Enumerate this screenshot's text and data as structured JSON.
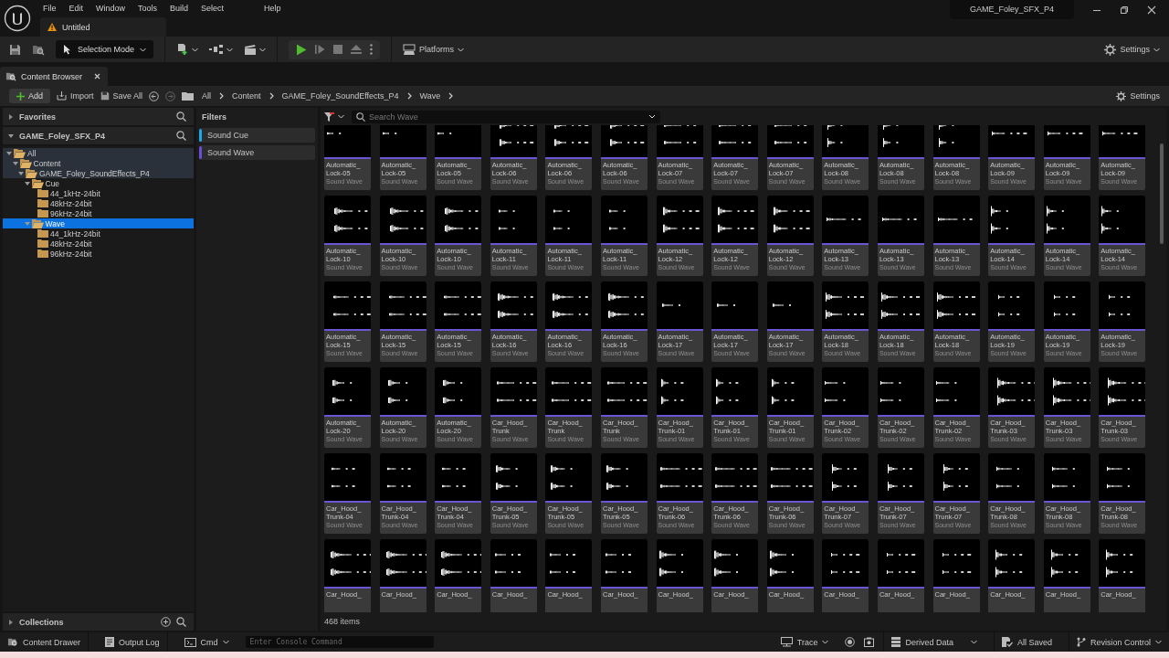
{
  "menu": [
    "File",
    "Edit",
    "Window",
    "Tools",
    "Build",
    "Select",
    "Help"
  ],
  "document_tab": {
    "title": "Untitled"
  },
  "project_name": "GAME_Foley_SFX_P4",
  "toolbar": {
    "mode": "Selection Mode",
    "platforms": "Platforms",
    "settings": "Settings"
  },
  "panel_tab": {
    "title": "Content Browser"
  },
  "browser_toolbar": {
    "add": "Add",
    "import": "Import",
    "save_all": "Save All",
    "breadcrumb": [
      "All",
      "Content",
      "GAME_Foley_SoundEffects_P4",
      "Wave"
    ],
    "settings": "Settings"
  },
  "sources": {
    "favorites": {
      "label": "Favorites",
      "expanded": false
    },
    "project": {
      "label": "GAME_Foley_SFX_P4",
      "expanded": true
    },
    "tree": [
      {
        "label": "All",
        "expanded": true,
        "selected": false,
        "children": [
          {
            "label": "Content",
            "expanded": true,
            "selected": false,
            "children": [
              {
                "label": "GAME_Foley_SoundEffects_P4",
                "expanded": true,
                "selected": false,
                "children": [
                  {
                    "label": "Cue",
                    "expanded": true,
                    "selected": false,
                    "children": [
                      {
                        "label": "44_1kHz-24bit",
                        "selected": false
                      },
                      {
                        "label": "48kHz-24bit",
                        "selected": false
                      },
                      {
                        "label": "96kHz-24bit",
                        "selected": false
                      }
                    ]
                  },
                  {
                    "label": "Wave",
                    "expanded": true,
                    "selected": true,
                    "children": [
                      {
                        "label": "44_1kHz-24bit",
                        "selected": false
                      },
                      {
                        "label": "48kHz-24bit",
                        "selected": false
                      },
                      {
                        "label": "96kHz-24bit",
                        "selected": false
                      }
                    ]
                  }
                ]
              }
            ]
          }
        ]
      }
    ],
    "collections": {
      "label": "Collections",
      "expanded": false
    }
  },
  "filters": {
    "title": "Filters",
    "items": [
      {
        "label": "Sound Cue",
        "color": "#1ca7ec"
      },
      {
        "label": "Sound Wave",
        "color": "#6b4fd6"
      }
    ]
  },
  "search": {
    "placeholder": "Search Wave"
  },
  "assets": [
    {
      "name": "Automatic_\nLock-05",
      "type": "Sound Wave"
    },
    {
      "name": "Automatic_\nLock-05",
      "type": "Sound Wave"
    },
    {
      "name": "Automatic_\nLock-05",
      "type": "Sound Wave"
    },
    {
      "name": "Automatic_\nLock-06",
      "type": "Sound Wave"
    },
    {
      "name": "Automatic_\nLock-06",
      "type": "Sound Wave"
    },
    {
      "name": "Automatic_\nLock-06",
      "type": "Sound Wave"
    },
    {
      "name": "Automatic_\nLock-07",
      "type": "Sound Wave"
    },
    {
      "name": "Automatic_\nLock-07",
      "type": "Sound Wave"
    },
    {
      "name": "Automatic_\nLock-07",
      "type": "Sound Wave"
    },
    {
      "name": "Automatic_\nLock-08",
      "type": "Sound Wave"
    },
    {
      "name": "Automatic_\nLock-08",
      "type": "Sound Wave"
    },
    {
      "name": "Automatic_\nLock-08",
      "type": "Sound Wave"
    },
    {
      "name": "Automatic_\nLock-09",
      "type": "Sound Wave"
    },
    {
      "name": "Automatic_\nLock-09",
      "type": "Sound Wave"
    },
    {
      "name": "Automatic_\nLock-09",
      "type": "Sound Wave"
    },
    {
      "name": "Automatic_\nLock-10",
      "type": "Sound Wave"
    },
    {
      "name": "Automatic_\nLock-10",
      "type": "Sound Wave"
    },
    {
      "name": "Automatic_\nLock-10",
      "type": "Sound Wave"
    },
    {
      "name": "Automatic_\nLock-11",
      "type": "Sound Wave"
    },
    {
      "name": "Automatic_\nLock-11",
      "type": "Sound Wave"
    },
    {
      "name": "Automatic_\nLock-11",
      "type": "Sound Wave"
    },
    {
      "name": "Automatic_\nLock-12",
      "type": "Sound Wave"
    },
    {
      "name": "Automatic_\nLock-12",
      "type": "Sound Wave"
    },
    {
      "name": "Automatic_\nLock-12",
      "type": "Sound Wave"
    },
    {
      "name": "Automatic_\nLock-13",
      "type": "Sound Wave"
    },
    {
      "name": "Automatic_\nLock-13",
      "type": "Sound Wave"
    },
    {
      "name": "Automatic_\nLock-13",
      "type": "Sound Wave"
    },
    {
      "name": "Automatic_\nLock-14",
      "type": "Sound Wave"
    },
    {
      "name": "Automatic_\nLock-14",
      "type": "Sound Wave"
    },
    {
      "name": "Automatic_\nLock-14",
      "type": "Sound Wave"
    },
    {
      "name": "Automatic_\nLock-15",
      "type": "Sound Wave"
    },
    {
      "name": "Automatic_\nLock-15",
      "type": "Sound Wave"
    },
    {
      "name": "Automatic_\nLock-15",
      "type": "Sound Wave"
    },
    {
      "name": "Automatic_\nLock-16",
      "type": "Sound Wave"
    },
    {
      "name": "Automatic_\nLock-16",
      "type": "Sound Wave"
    },
    {
      "name": "Automatic_\nLock-16",
      "type": "Sound Wave"
    },
    {
      "name": "Automatic_\nLock-17",
      "type": "Sound Wave"
    },
    {
      "name": "Automatic_\nLock-17",
      "type": "Sound Wave"
    },
    {
      "name": "Automatic_\nLock-17",
      "type": "Sound Wave"
    },
    {
      "name": "Automatic_\nLock-18",
      "type": "Sound Wave"
    },
    {
      "name": "Automatic_\nLock-18",
      "type": "Sound Wave"
    },
    {
      "name": "Automatic_\nLock-18",
      "type": "Sound Wave"
    },
    {
      "name": "Automatic_\nLock-19",
      "type": "Sound Wave"
    },
    {
      "name": "Automatic_\nLock-19",
      "type": "Sound Wave"
    },
    {
      "name": "Automatic_\nLock-19",
      "type": "Sound Wave"
    },
    {
      "name": "Automatic_\nLock-20",
      "type": "Sound Wave"
    },
    {
      "name": "Automatic_\nLock-20",
      "type": "Sound Wave"
    },
    {
      "name": "Automatic_\nLock-20",
      "type": "Sound Wave"
    },
    {
      "name": "Car_Hood_\nTrunk",
      "type": "Sound Wave"
    },
    {
      "name": "Car_Hood_\nTrunk",
      "type": "Sound Wave"
    },
    {
      "name": "Car_Hood_\nTrunk",
      "type": "Sound Wave"
    },
    {
      "name": "Car_Hood_\nTrunk-01",
      "type": "Sound Wave"
    },
    {
      "name": "Car_Hood_\nTrunk-01",
      "type": "Sound Wave"
    },
    {
      "name": "Car_Hood_\nTrunk-01",
      "type": "Sound Wave"
    },
    {
      "name": "Car_Hood_\nTrunk-02",
      "type": "Sound Wave"
    },
    {
      "name": "Car_Hood_\nTrunk-02",
      "type": "Sound Wave"
    },
    {
      "name": "Car_Hood_\nTrunk-02",
      "type": "Sound Wave"
    },
    {
      "name": "Car_Hood_\nTrunk-03",
      "type": "Sound Wave"
    },
    {
      "name": "Car_Hood_\nTrunk-03",
      "type": "Sound Wave"
    },
    {
      "name": "Car_Hood_\nTrunk-03",
      "type": "Sound Wave"
    },
    {
      "name": "Car_Hood_\nTrunk-04",
      "type": "Sound Wave"
    },
    {
      "name": "Car_Hood_\nTrunk-04",
      "type": "Sound Wave"
    },
    {
      "name": "Car_Hood_\nTrunk-04",
      "type": "Sound Wave"
    },
    {
      "name": "Car_Hood_\nTrunk-05",
      "type": "Sound Wave"
    },
    {
      "name": "Car_Hood_\nTrunk-05",
      "type": "Sound Wave"
    },
    {
      "name": "Car_Hood_\nTrunk-05",
      "type": "Sound Wave"
    },
    {
      "name": "Car_Hood_\nTrunk-06",
      "type": "Sound Wave"
    },
    {
      "name": "Car_Hood_\nTrunk-06",
      "type": "Sound Wave"
    },
    {
      "name": "Car_Hood_\nTrunk-06",
      "type": "Sound Wave"
    },
    {
      "name": "Car_Hood_\nTrunk-07",
      "type": "Sound Wave"
    },
    {
      "name": "Car_Hood_\nTrunk-07",
      "type": "Sound Wave"
    },
    {
      "name": "Car_Hood_\nTrunk-07",
      "type": "Sound Wave"
    },
    {
      "name": "Car_Hood_\nTrunk-08",
      "type": "Sound Wave"
    },
    {
      "name": "Car_Hood_\nTrunk-08",
      "type": "Sound Wave"
    },
    {
      "name": "Car_Hood_\nTrunk-08",
      "type": "Sound Wave"
    },
    {
      "name": "Car_Hood_"
    },
    {
      "name": "Car_Hood_"
    },
    {
      "name": "Car_Hood_"
    },
    {
      "name": "Car_Hood_"
    },
    {
      "name": "Car_Hood_"
    },
    {
      "name": "Car_Hood_"
    },
    {
      "name": "Car_Hood_"
    },
    {
      "name": "Car_Hood_"
    },
    {
      "name": "Car_Hood_"
    },
    {
      "name": "Car_Hood_"
    },
    {
      "name": "Car_Hood_"
    },
    {
      "name": "Car_Hood_"
    },
    {
      "name": "Car_Hood_"
    },
    {
      "name": "Car_Hood_"
    },
    {
      "name": "Car_Hood_"
    }
  ],
  "item_count": "468 items",
  "status_bar": {
    "content_drawer": "Content Drawer",
    "output_log": "Output Log",
    "cmd": "Cmd",
    "console_placeholder": "Enter Console Command",
    "trace": "Trace",
    "derived_data": "Derived Data",
    "saved": "All Saved",
    "revision_control": "Revision Control"
  }
}
